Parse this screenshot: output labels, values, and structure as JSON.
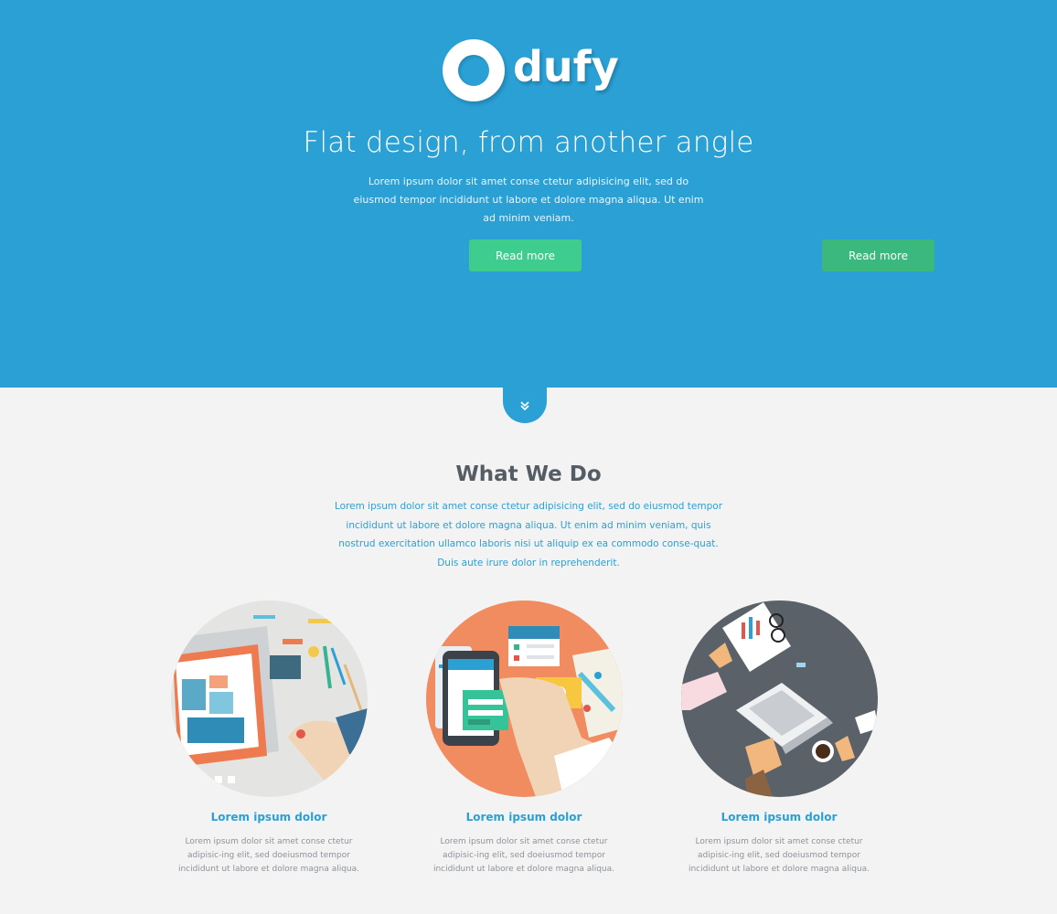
{
  "hero": {
    "logo_text": "dufy",
    "title": "Flat design, from another angle",
    "subtitle": "Lorem ipsum dolor sit amet conse ctetur adipisicing elit, sed do eiusmod tempor incididunt ut labore et dolore magna aliqua. Ut enim ad minim veniam.",
    "buttons": [
      {
        "label": "Read more"
      },
      {
        "label": "Read more"
      }
    ],
    "scroll_icon": "double-chevron-down-icon"
  },
  "what_we_do": {
    "title": "What We Do",
    "text": "Lorem ipsum dolor sit amet conse ctetur adipisicing elit, sed do eiusmod tempor incididunt ut labore et dolore magna aliqua. Ut enim ad minim veniam, quis nostrud exercitation ullamco laboris nisi ut aliquip ex ea commodo conse-quat. Duis aute irure dolor in reprehenderit.",
    "features": [
      {
        "image": "tablet-design-illustration",
        "title": "Lorem ipsum dolor",
        "text": "Lorem ipsum dolor sit amet conse ctetur adipisic-ing elit, sed doeiusmod tempor incididunt ut labore et dolore magna aliqua."
      },
      {
        "image": "mobile-app-illustration",
        "title": "Lorem ipsum dolor",
        "text": "Lorem ipsum dolor sit amet conse ctetur adipisic-ing elit, sed doeiusmod tempor incididunt ut labore et dolore magna aliqua."
      },
      {
        "image": "laptop-desk-illustration",
        "title": "Lorem ipsum dolor",
        "text": "Lorem ipsum dolor sit amet conse ctetur adipisic-ing elit, sed doeiusmod tempor incididunt ut labore et dolore magna aliqua."
      }
    ]
  },
  "colors": {
    "hero_bg": "#2aa0d5",
    "button": "#3ecd8e",
    "button_alt": "#3bb87d",
    "page_bg": "#f3f3f4",
    "heading": "#555d64",
    "accent_text": "#2aa0d5"
  }
}
